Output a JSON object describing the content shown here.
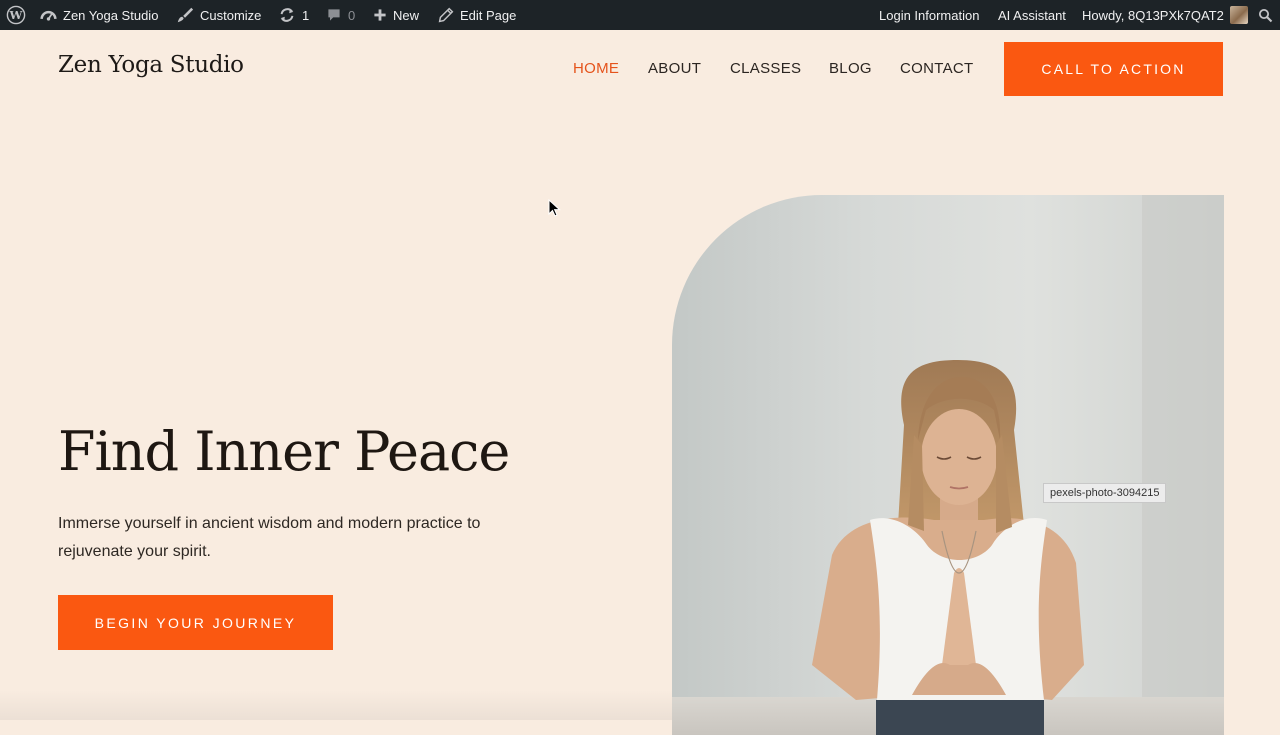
{
  "adminbar": {
    "site_name": "Zen Yoga Studio",
    "customize": "Customize",
    "updates_count": "1",
    "comments_count": "0",
    "new": "New",
    "edit_page": "Edit Page",
    "login_information": "Login Information",
    "ai_assistant": "AI Assistant",
    "howdy": "Howdy, 8Q13PXk7QAT2",
    "icons": [
      "wordpress-icon",
      "dashboard-icon",
      "paintbrush-icon",
      "updates-icon",
      "comment-icon",
      "plus-icon",
      "pencil-icon",
      "search-icon"
    ]
  },
  "header": {
    "logo": "Zen Yoga Studio",
    "nav": [
      {
        "label": "HOME",
        "active": true
      },
      {
        "label": "ABOUT",
        "active": false
      },
      {
        "label": "CLASSES",
        "active": false
      },
      {
        "label": "BLOG",
        "active": false
      },
      {
        "label": "CONTACT",
        "active": false
      }
    ],
    "cta": "CALL TO ACTION"
  },
  "hero": {
    "title": "Find Inner Peace",
    "subtitle": "Immerse yourself in ancient wisdom and modern practice to rejuvenate your spirit.",
    "button": "BEGIN YOUR JOURNEY",
    "image_tooltip": "pexels-photo-3094215"
  },
  "colors": {
    "adminbar_bg": "#1d2327",
    "page_bg": "#f9ece0",
    "accent": "#fa5811",
    "nav_active": "#e5531b",
    "text_dark": "#1e1712"
  }
}
